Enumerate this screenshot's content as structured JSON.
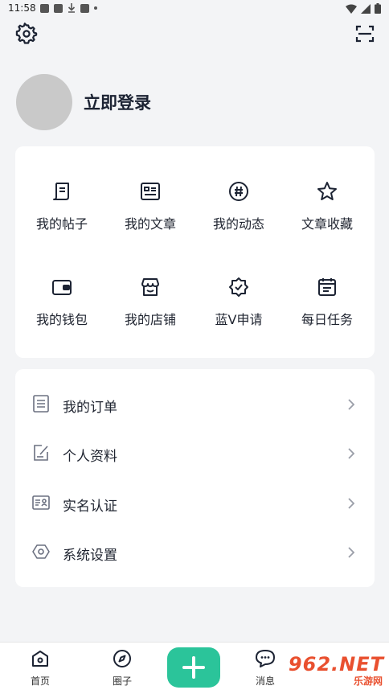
{
  "status_bar": {
    "time": "11:58"
  },
  "header": {
    "login_text": "立即登录"
  },
  "grid": {
    "items": [
      {
        "label": "我的帖子"
      },
      {
        "label": "我的文章"
      },
      {
        "label": "我的动态"
      },
      {
        "label": "文章收藏"
      },
      {
        "label": "我的钱包"
      },
      {
        "label": "我的店铺"
      },
      {
        "label": "蓝V申请"
      },
      {
        "label": "每日任务"
      }
    ]
  },
  "list": {
    "items": [
      {
        "label": "我的订单"
      },
      {
        "label": "个人资料"
      },
      {
        "label": "实名认证"
      },
      {
        "label": "系统设置"
      }
    ]
  },
  "tabbar": {
    "tabs": [
      {
        "label": "首页"
      },
      {
        "label": "圈子"
      },
      {
        "label": "消息"
      }
    ]
  },
  "watermark": {
    "text": "962.NET",
    "sub": "乐游网"
  },
  "colors": {
    "accent": "#2bc49a",
    "background": "#f3f4f6",
    "avatar": "#c9c9c9"
  }
}
